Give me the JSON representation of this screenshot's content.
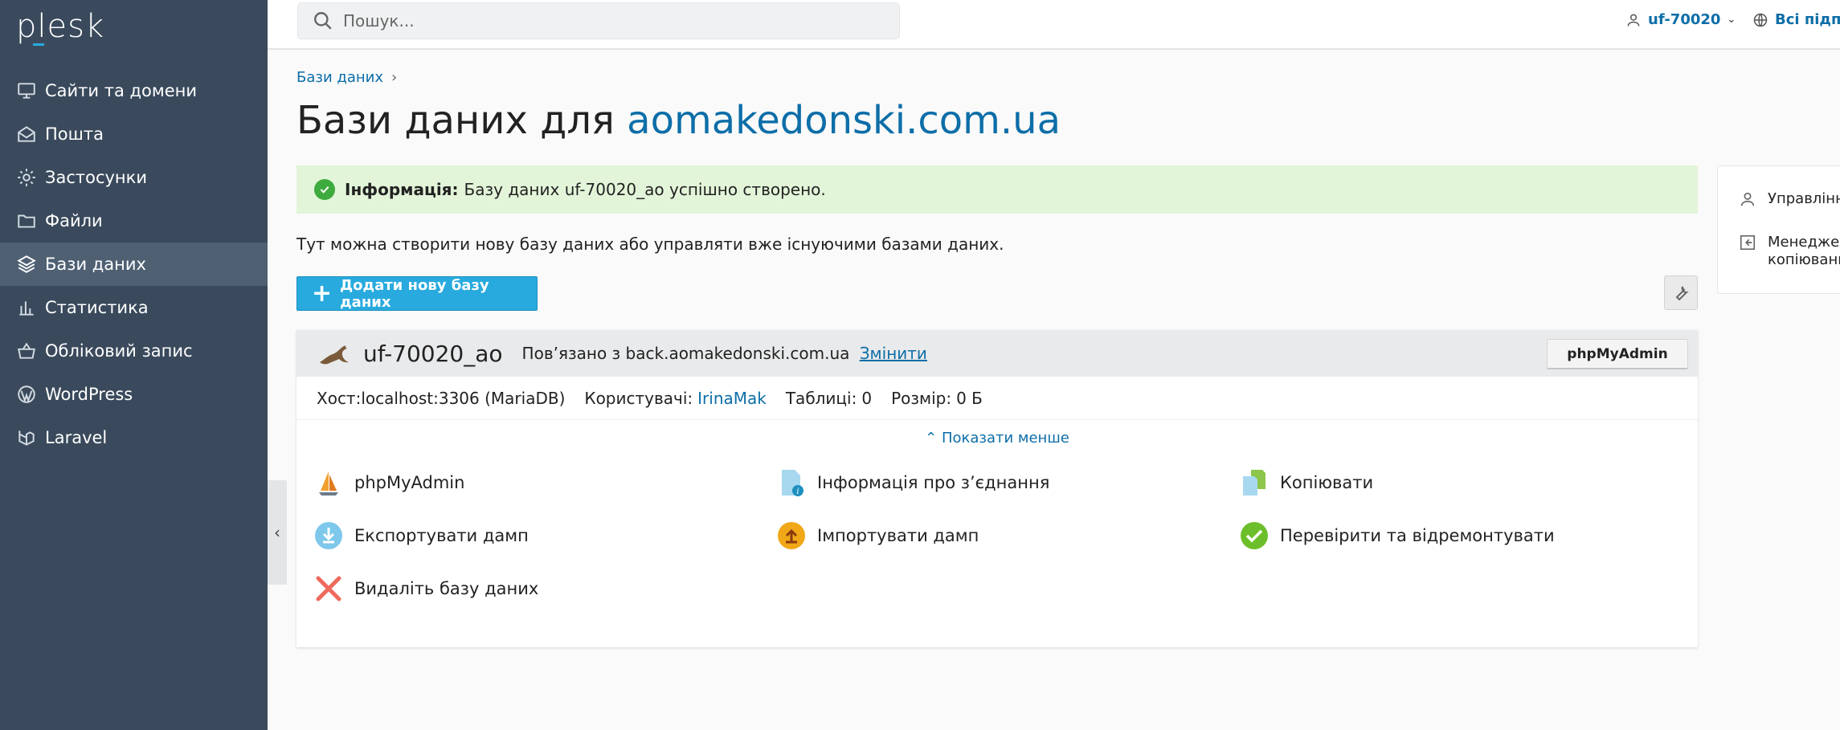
{
  "app": {
    "logo": "plesk"
  },
  "sidebar": {
    "items": [
      {
        "label": "Сайти та домени",
        "icon": "monitor-icon"
      },
      {
        "label": "Пошта",
        "icon": "mail-icon"
      },
      {
        "label": "Застосунки",
        "icon": "gear-icon"
      },
      {
        "label": "Файли",
        "icon": "folder-icon"
      },
      {
        "label": "Бази даних",
        "icon": "layers-icon",
        "active": true
      },
      {
        "label": "Статистика",
        "icon": "bar-chart-icon"
      },
      {
        "label": "Обліковий запис",
        "icon": "basket-icon"
      },
      {
        "label": "WordPress",
        "icon": "wordpress-icon"
      },
      {
        "label": "Laravel",
        "icon": "laravel-icon"
      }
    ]
  },
  "topbar": {
    "search_placeholder": "Пошук...",
    "user": "uf-70020",
    "subscriptions": "Всі підпи"
  },
  "breadcrumb": {
    "item": "Бази даних"
  },
  "page": {
    "title_prefix": "Бази даних для",
    "title_domain": "aomakedonski.com.ua",
    "alert_label": "Інформація:",
    "alert_text": "Базу даних uf-70020_ao успішно створено.",
    "intro": "Тут можна створити нову базу даних або управляти вже існуючими базами даних.",
    "add_button": "Додати нову базу даних"
  },
  "database": {
    "name": "uf-70020_ao",
    "linked_text": "Пов’язано з back.aomakedonski.com.ua",
    "change_link": "Змінити",
    "pma_button": "phpMyAdmin",
    "host_label": "Хост:",
    "host_value": "localhost:3306 (MariaDB)",
    "users_label": "Користувачі:",
    "users_value": "IrinaMak",
    "tables_label": "Таблиці:",
    "tables_value": "0",
    "size_label": "Розмір:",
    "size_value": "0 Б",
    "show_less": "Показати менше",
    "actions": {
      "phpmyadmin": "phpMyAdmin",
      "connection_info": "Інформація про з’єднання",
      "copy": "Копіювати",
      "export": "Експортувати дамп",
      "import": "Імпортувати дамп",
      "check_repair": "Перевірити та відремонтувати",
      "delete": "Видаліть базу даних"
    }
  },
  "right_panel": {
    "item1": "Управління",
    "item2_line1": "Менеджер",
    "item2_line2": "копіюванн"
  },
  "colors": {
    "sidebar_bg": "#3a4a5c",
    "sidebar_active": "#4f6073",
    "link": "#0d6ea8",
    "primary_button": "#28aade",
    "success_bg": "#e3f5d9"
  }
}
